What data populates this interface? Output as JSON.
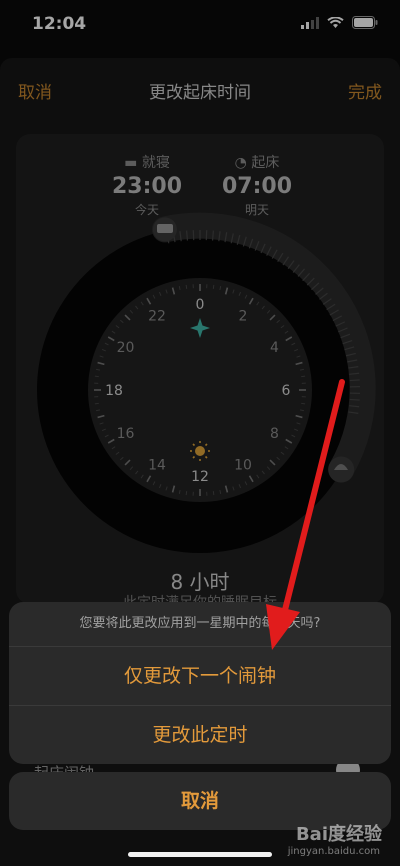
{
  "status": {
    "time": "12:04"
  },
  "nav": {
    "cancel": "取消",
    "title": "更改起床时间",
    "done": "完成"
  },
  "bedtime": {
    "label": "就寝",
    "time": "23:00",
    "day": "今天"
  },
  "wake": {
    "label": "起床",
    "time": "07:00",
    "day": "明天"
  },
  "dial": {
    "numbers": [
      "0",
      "2",
      "4",
      "6",
      "8",
      "10",
      "12",
      "14",
      "16",
      "18",
      "20",
      "22"
    ]
  },
  "duration": "8 小时",
  "goal_text": "此定时满足你的睡眠目标",
  "underlying_row": "起床闹钟",
  "action_sheet": {
    "message": "您要将此更改应用到一星期中的每一天吗?",
    "option1": "仅更改下一个闹钟",
    "option2": "更改此定时",
    "cancel": "取消"
  },
  "watermark": {
    "brand": "Bai度经验",
    "url": "jingyan.baidu.com"
  },
  "colors": {
    "accent": "#e39a3b",
    "arrow": "#e11c1c"
  }
}
